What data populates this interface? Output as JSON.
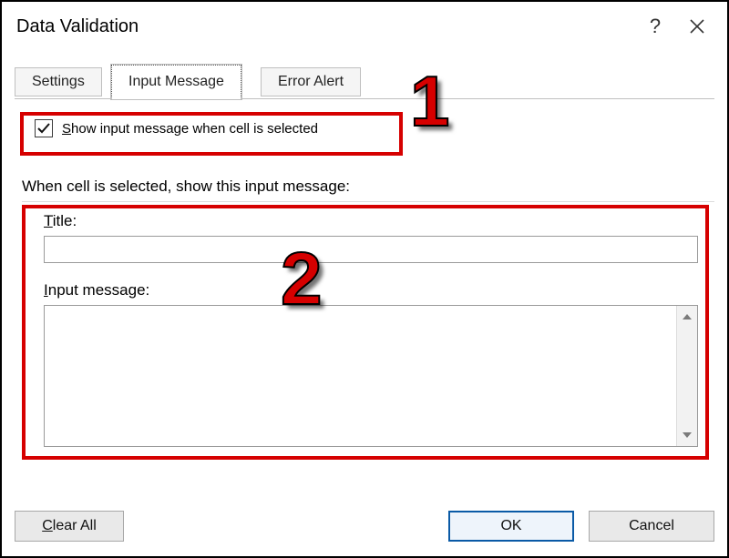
{
  "window": {
    "title": "Data Validation"
  },
  "tabs": {
    "settings": "Settings",
    "input_message": "Input Message",
    "error_alert": "Error Alert"
  },
  "checkbox": {
    "label_pre": "S",
    "label_rest": "how input message when cell is selected",
    "checked": true
  },
  "section_heading": "When cell is selected, show this input message:",
  "fields": {
    "title_pre": "T",
    "title_rest": "itle:",
    "title_value": "",
    "msg_pre": "I",
    "msg_rest": "nput message:",
    "msg_value": ""
  },
  "callouts": {
    "one": "1",
    "two": "2"
  },
  "buttons": {
    "clear_pre": "C",
    "clear_rest": "lear All",
    "ok": "OK",
    "cancel": "Cancel"
  }
}
